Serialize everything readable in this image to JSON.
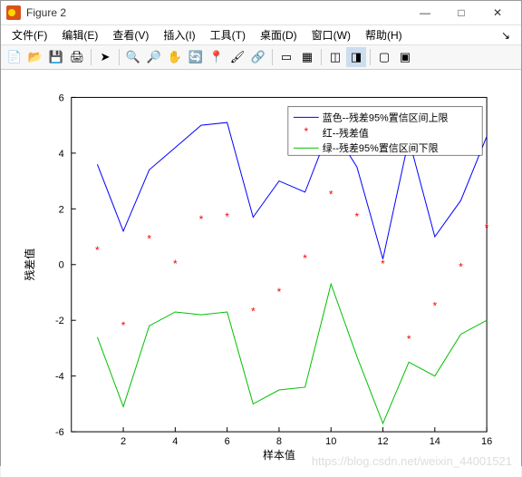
{
  "window": {
    "title": "Figure 2"
  },
  "menu": {
    "file": "文件(F)",
    "edit": "编辑(E)",
    "view": "查看(V)",
    "insert": "插入(I)",
    "tools": "工具(T)",
    "desktop": "桌面(D)",
    "window": "窗口(W)",
    "help": "帮助(H)",
    "dock": "↘"
  },
  "chart_data": {
    "type": "line",
    "xlabel": "样本值",
    "ylabel": "残差值",
    "xlim": [
      0,
      16
    ],
    "ylim": [
      -6,
      6
    ],
    "xticks": [
      2,
      4,
      6,
      8,
      10,
      12,
      14,
      16
    ],
    "yticks": [
      -6,
      -4,
      -2,
      0,
      2,
      4,
      6
    ],
    "categories": [
      1,
      2,
      3,
      4,
      5,
      6,
      7,
      8,
      9,
      10,
      11,
      12,
      13,
      14,
      15,
      16
    ],
    "series": [
      {
        "name": "蓝色--残差95%置信区间上限",
        "type": "line",
        "color": "#0000ff",
        "values": [
          3.6,
          1.2,
          3.4,
          4.2,
          5.0,
          5.1,
          1.7,
          3.0,
          2.6,
          5.0,
          3.5,
          0.2,
          4.5,
          1.0,
          2.3,
          4.6
        ]
      },
      {
        "name": "红--残差值",
        "type": "scatter",
        "color": "#ff0000",
        "values": [
          0.5,
          -2.2,
          0.9,
          0.0,
          1.6,
          1.7,
          -1.7,
          -1.0,
          0.2,
          2.5,
          1.7,
          0.0,
          -2.7,
          -1.5,
          -0.1,
          1.3
        ]
      },
      {
        "name": "绿--残差95%置信区间下限",
        "type": "line",
        "color": "#00c000",
        "values": [
          -2.6,
          -5.1,
          -2.2,
          -1.7,
          -1.8,
          -1.7,
          -5.0,
          -4.5,
          -4.4,
          -0.7,
          -3.3,
          -5.7,
          -3.5,
          -4.0,
          -2.5,
          -2.0
        ]
      }
    ],
    "legend": {
      "upper": "蓝色--残差95%置信区间上限",
      "resid": "红--残差值",
      "lower": "绿--残差95%置信区间下限"
    }
  },
  "watermark": "https://blog.csdn.net/weixin_44001521"
}
